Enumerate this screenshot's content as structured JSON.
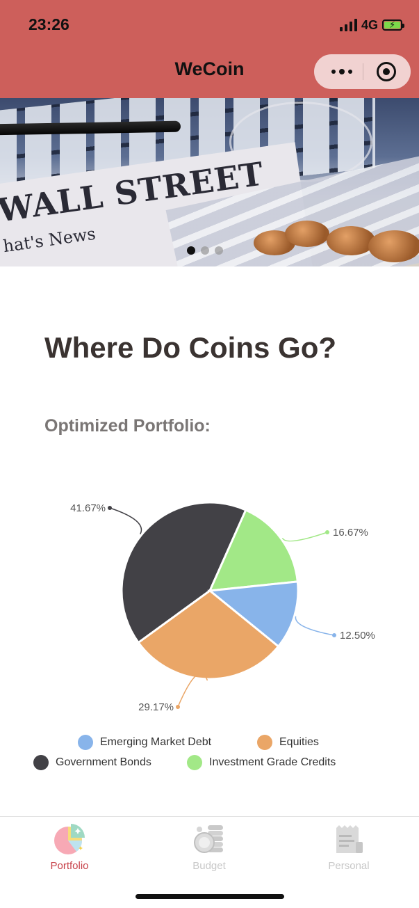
{
  "status_bar": {
    "time": "23:26",
    "network": "4G"
  },
  "nav_bar": {
    "title": "WeCoin"
  },
  "banner": {
    "headline": "WALL STREET",
    "subline": "hat's News",
    "slide_count": 3,
    "active_slide": 1
  },
  "content": {
    "title": "Where Do Coins Go?",
    "subtitle": "Optimized Portfolio:"
  },
  "chart_data": {
    "type": "pie",
    "series": [
      {
        "name": "Government Bonds",
        "value": 41.67,
        "label": "41.67%",
        "color": "#424146"
      },
      {
        "name": "Investment Grade Credits",
        "value": 16.67,
        "label": "16.67%",
        "color": "#a2e887"
      },
      {
        "name": "Emerging Market Debt",
        "value": 12.5,
        "label": "12.50%",
        "color": "#88b4ea"
      },
      {
        "name": "Equities",
        "value": 29.17,
        "label": "29.17%",
        "color": "#eaa667"
      }
    ],
    "legend": [
      "Emerging Market Debt",
      "Equities",
      "Government Bonds",
      "Investment Grade Credits"
    ],
    "legend_placement": "bottom"
  },
  "tabs": [
    {
      "label": "Portfolio",
      "icon": "pie-chart-icon",
      "active": true
    },
    {
      "label": "Budget",
      "icon": "coins-icon",
      "active": false
    },
    {
      "label": "Personal",
      "icon": "receipt-icon",
      "active": false
    }
  ],
  "colors": {
    "header": "#cd5f5b",
    "tab_active": "#c7424a",
    "tab_inactive": "#c8c8c8"
  }
}
